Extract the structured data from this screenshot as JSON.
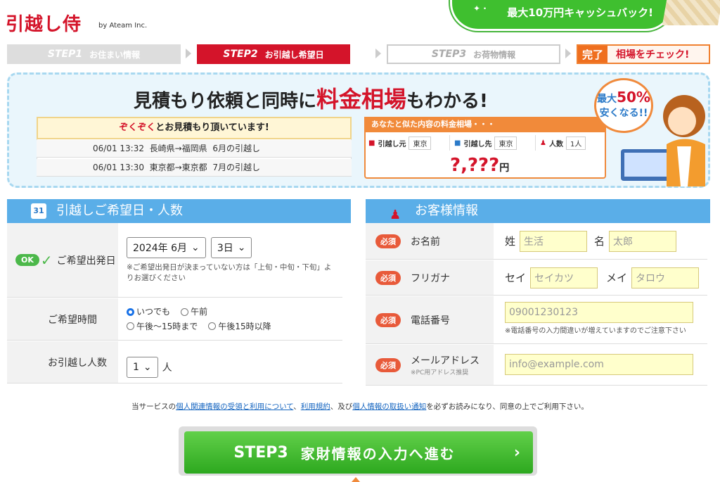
{
  "header": {
    "logo": "引越し侍",
    "byline": "by Ateam Inc.",
    "banner": "最大10万円キャッシュバック!"
  },
  "steps": [
    {
      "label": "STEP1",
      "sub": "お住まい情報",
      "state": "done"
    },
    {
      "label": "STEP2",
      "sub": "お引越し希望日",
      "state": "active"
    },
    {
      "label": "STEP3",
      "sub": "お荷物情報",
      "state": "todo"
    },
    {
      "done": "完了",
      "label": "相場をチェック!",
      "state": "todo"
    }
  ],
  "hero": {
    "title_a": "見積もり依頼と同時に",
    "title_hl": "料金相場",
    "title_b": "もわかる!",
    "stream_head_red": "ぞくぞく",
    "stream_head": "とお見積もり頂いています!",
    "stream": [
      {
        "time": "06/01 13:32",
        "route": "長崎県→福岡県",
        "month": "6月の引越し"
      },
      {
        "time": "06/01 13:30",
        "route": "東京都→東京都",
        "month": "7月の引越し"
      }
    ],
    "rate_head": "あなたと似た内容の料金相場・・・",
    "rate_from_label": "引越し元",
    "rate_from": "東京",
    "rate_to_label": "引越し先",
    "rate_to": "東京",
    "rate_ppl_label": "人数",
    "rate_ppl": "1人",
    "rate_price": "?,???",
    "rate_unit": "円",
    "badge_top": "最大",
    "badge_pct": "50%",
    "badge_bot": "安くなる!!"
  },
  "schedule": {
    "title": "引越しご希望日・人数",
    "date_label": "ご希望出発日",
    "ok": "OK",
    "year_month": "2024年 6月",
    "day": "3日",
    "date_note": "※ご希望出発日が決まっていない方は「上旬・中旬・下旬」よりお選びください",
    "time_label": "ご希望時間",
    "time_options": [
      "いつでも",
      "午前",
      "午後～15時まで",
      "午後15時以降"
    ],
    "time_selected": "いつでも",
    "people_label": "お引越し人数",
    "people": "1",
    "people_unit": "人"
  },
  "customer": {
    "title": "お客様情報",
    "required": "必須",
    "name_label": "お名前",
    "sei": "姓",
    "mei": "名",
    "sei_ph": "生活",
    "mei_ph": "太郎",
    "kana_label": "フリガナ",
    "sei_k": "セイ",
    "mei_k": "メイ",
    "sei_k_ph": "セイカツ",
    "mei_k_ph": "タロウ",
    "tel_label": "電話番号",
    "tel_ph": "09001230123",
    "tel_note": "※電話番号の入力間違いが増えていますのでご注意下さい",
    "mail_label": "メールアドレス",
    "mail_sub": "※PC用アドレス推奨",
    "mail_ph": "info@example.com"
  },
  "footer": {
    "pre": "当サービスの",
    "link1": "個人関連情報の受領と利用について",
    "sep1": "、",
    "link2": "利用規約",
    "sep2": "、及び",
    "link3": "個人情報の取扱い通知",
    "post": "を必ずお読みになり、同意の上でご利用下さい。",
    "cta_step": "STEP3",
    "cta_text": "家財情報の入力へ進む",
    "cta_arrow": "›"
  },
  "colors": {
    "brand": "#d4142a",
    "section": "#5aaee8",
    "cta": "#3cbf2c",
    "required": "#e85a3a"
  }
}
